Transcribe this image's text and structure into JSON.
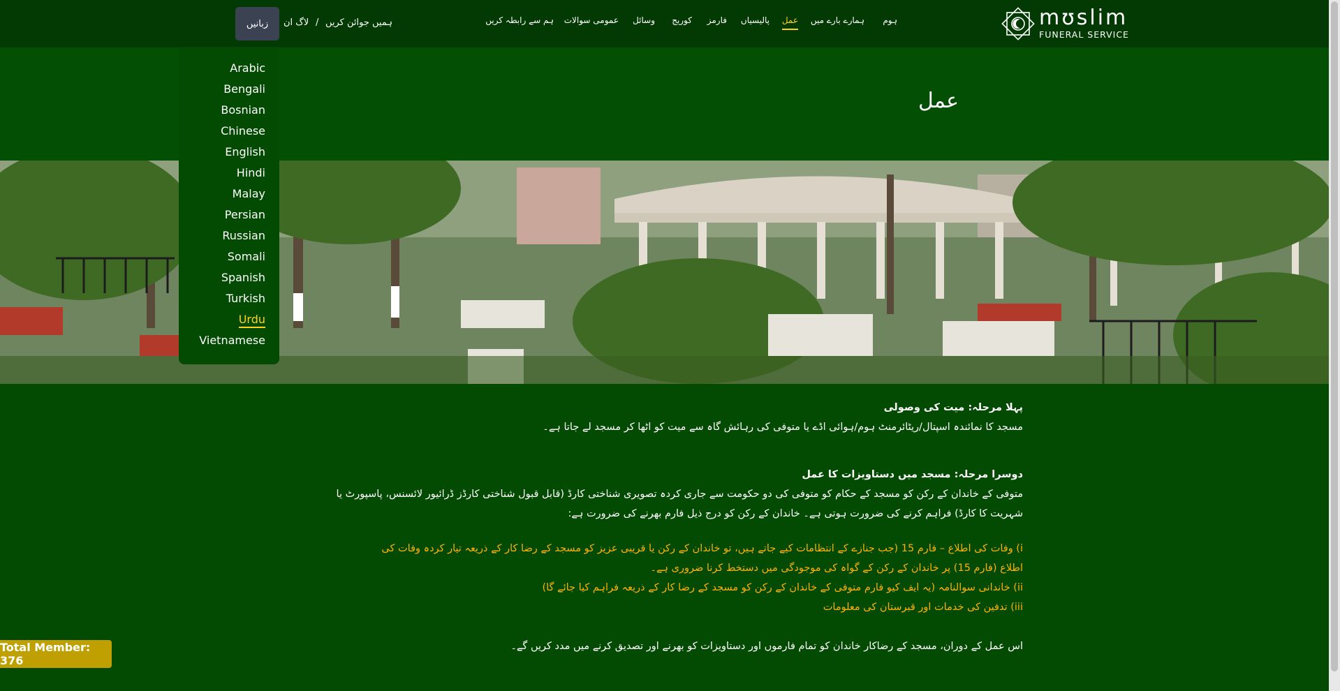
{
  "brand": {
    "name": "mʊslim",
    "subtitle": "FUNERAL SERVICE"
  },
  "nav": {
    "items": [
      {
        "label": "ہوم",
        "active": false
      },
      {
        "label": "ہمارے بارے میں",
        "active": false
      },
      {
        "label": "عمل",
        "active": true
      },
      {
        "label": "پالیسیاں",
        "active": false
      },
      {
        "label": "فارمز",
        "active": false
      },
      {
        "label": "کوریج",
        "active": false
      },
      {
        "label": "وسائل",
        "active": false
      },
      {
        "label": "عمومی سوالات",
        "active": false
      },
      {
        "label": "ہم سے رابطہ کریں",
        "active": false
      }
    ],
    "join_label": "ہمیں جوائن کریں",
    "separator": "/",
    "login_label": "لاگ ان",
    "language_button": "زبانیں"
  },
  "language_menu": {
    "items": [
      "Arabic",
      "Bengali",
      "Bosnian",
      "Chinese",
      "English",
      "Hindi",
      "Malay",
      "Persian",
      "Russian",
      "Somali",
      "Spanish",
      "Turkish",
      "Urdu",
      "Vietnamese"
    ],
    "selected": "Urdu"
  },
  "page": {
    "title": "عمل"
  },
  "content": {
    "step1_heading": "پہلا مرحلہ: میت کی وصولی",
    "step1_text": "مسجد کا نمائندہ اسپتال/ریٹائرمنٹ ہوم/ہوائی اڈے یا متوفی کی رہائش گاہ سے میت کو اٹھا کر مسجد لے جاتا ہے۔",
    "step2_heading": "دوسرا مرحلہ: مسجد میں دستاویزات کا عمل",
    "step2_text_line1": "متوفی کے خاندان کے رکن کو مسجد کے حکام کو متوفی کی دو حکومت سے جاری کردہ تصویری شناختی کارڈ (قابل قبول شناختی کارڈز ڈرائیور لائسنس، پاسپورٹ یا",
    "step2_text_line2": "شہریت کا کارڈ) فراہم کرنے کی ضرورت ہوتی ہے۔ خاندان کے رکن کو درج ذیل فارم بھرنے کی ضرورت ہے:",
    "list_i_line1": "i) وفات کی اطلاع – فارم 15 (جب جنازے کے انتظامات کیے جاتے ہیں، تو خاندان کے رکن یا قریبی عزیز کو مسجد کے رضا کار کے ذریعہ تیار کردہ وفات کی",
    "list_i_line2": "اطلاع (فارم 15) پر خاندان کے رکن کے گواہ کی موجودگی میں دستخط کرنا ضروری ہے۔",
    "list_ii": "ii) خاندانی سوالنامہ (یہ ایف کیو فارم متوفی کے خاندان کے رکن کو مسجد کے رضا کار کے ذریعہ فراہم کیا جائے گا)",
    "list_iii": "iii) تدفین کی خدمات اور قبرستان کی معلومات",
    "closing_text": "اس عمل کے دوران، مسجد کے رضاکار خاندان کو تمام فارموں اور دستاویزات کو بھرنے اور تصدیق کرنے میں مدد کریں گے۔"
  },
  "member_badge": "Total Member: 376",
  "colors": {
    "background": "#034a03",
    "header": "#033a03",
    "accent": "#ffd21a",
    "list_text": "#ffb000",
    "badge": "#c0a000"
  }
}
